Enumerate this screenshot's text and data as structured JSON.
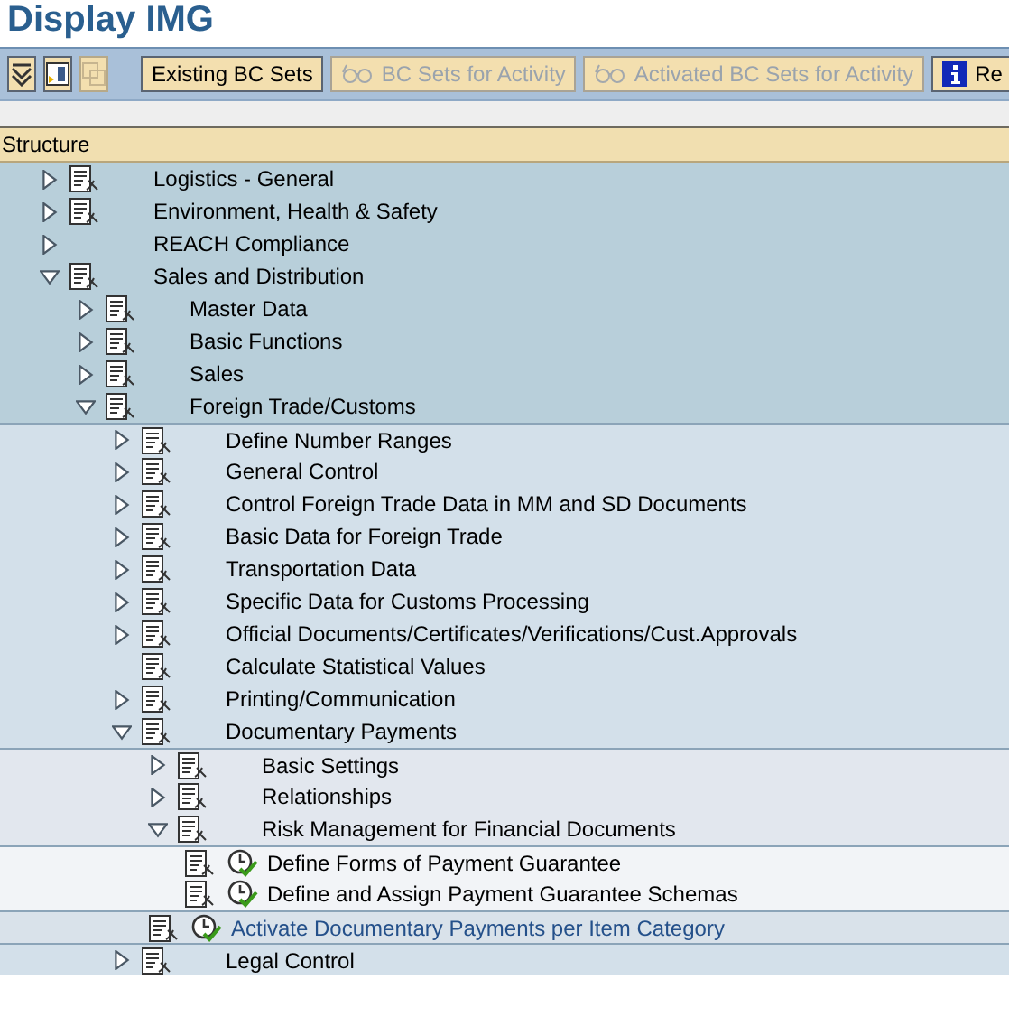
{
  "title": "Display IMG",
  "toolbar": [
    {
      "kind": "icon",
      "disabled": false
    },
    {
      "kind": "icon",
      "disabled": false
    },
    {
      "kind": "icon",
      "disabled": true
    },
    {
      "kind": "text",
      "label": "Existing BC Sets",
      "disabled": false
    },
    {
      "kind": "text",
      "label": "BC Sets for Activity",
      "disabled": true
    },
    {
      "kind": "text",
      "label": "Activated BC Sets for Activity",
      "disabled": true
    },
    {
      "kind": "text",
      "label": "Re",
      "disabled": false
    }
  ],
  "tree_header": "Structure",
  "tree": [
    {
      "label": "Logistics - General",
      "expandable": true,
      "expanded": false,
      "doc_icon": true,
      "activity_icon": false,
      "selected": false
    },
    {
      "label": "Environment, Health & Safety",
      "expandable": true,
      "expanded": false,
      "doc_icon": true,
      "activity_icon": false,
      "selected": false
    },
    {
      "label": "REACH Compliance",
      "expandable": true,
      "expanded": false,
      "doc_icon": false,
      "activity_icon": false,
      "selected": false
    },
    {
      "label": "Sales and Distribution",
      "expandable": true,
      "expanded": true,
      "doc_icon": true,
      "activity_icon": false,
      "selected": false,
      "children": [
        {
          "label": "Master Data",
          "expandable": true,
          "expanded": false,
          "doc_icon": true,
          "activity_icon": false,
          "selected": false
        },
        {
          "label": "Basic Functions",
          "expandable": true,
          "expanded": false,
          "doc_icon": true,
          "activity_icon": false,
          "selected": false
        },
        {
          "label": "Sales",
          "expandable": true,
          "expanded": false,
          "doc_icon": true,
          "activity_icon": false,
          "selected": false
        },
        {
          "label": "Foreign Trade/Customs",
          "expandable": true,
          "expanded": true,
          "doc_icon": true,
          "activity_icon": false,
          "selected": false,
          "children": [
            {
              "label": "Define Number Ranges",
              "expandable": true,
              "expanded": false,
              "doc_icon": true,
              "activity_icon": false,
              "selected": false
            },
            {
              "label": "General Control",
              "expandable": true,
              "expanded": false,
              "doc_icon": true,
              "activity_icon": false,
              "selected": false
            },
            {
              "label": "Control Foreign Trade Data in MM and SD Documents",
              "expandable": true,
              "expanded": false,
              "doc_icon": true,
              "activity_icon": false,
              "selected": false
            },
            {
              "label": "Basic Data for Foreign Trade",
              "expandable": true,
              "expanded": false,
              "doc_icon": true,
              "activity_icon": false,
              "selected": false
            },
            {
              "label": "Transportation Data",
              "expandable": true,
              "expanded": false,
              "doc_icon": true,
              "activity_icon": false,
              "selected": false
            },
            {
              "label": "Specific Data for Customs Processing",
              "expandable": true,
              "expanded": false,
              "doc_icon": true,
              "activity_icon": false,
              "selected": false
            },
            {
              "label": "Official Documents/Certificates/Verifications/Cust.Approvals",
              "expandable": true,
              "expanded": false,
              "doc_icon": true,
              "activity_icon": false,
              "selected": false
            },
            {
              "label": "Calculate Statistical Values",
              "expandable": false,
              "expanded": false,
              "doc_icon": true,
              "activity_icon": false,
              "selected": false
            },
            {
              "label": "Printing/Communication",
              "expandable": true,
              "expanded": false,
              "doc_icon": true,
              "activity_icon": false,
              "selected": false
            },
            {
              "label": "Documentary Payments",
              "expandable": true,
              "expanded": true,
              "doc_icon": true,
              "activity_icon": false,
              "selected": false,
              "children": [
                {
                  "label": "Basic Settings",
                  "expandable": true,
                  "expanded": false,
                  "doc_icon": true,
                  "activity_icon": false,
                  "selected": false
                },
                {
                  "label": "Relationships",
                  "expandable": true,
                  "expanded": false,
                  "doc_icon": true,
                  "activity_icon": false,
                  "selected": false
                },
                {
                  "label": "Risk Management for Financial Documents",
                  "expandable": true,
                  "expanded": true,
                  "doc_icon": true,
                  "activity_icon": false,
                  "selected": false,
                  "children": [
                    {
                      "label": "Define Forms of Payment Guarantee",
                      "expandable": false,
                      "expanded": false,
                      "doc_icon": true,
                      "activity_icon": true,
                      "selected": false
                    },
                    {
                      "label": "Define and Assign Payment Guarantee Schemas",
                      "expandable": false,
                      "expanded": false,
                      "doc_icon": true,
                      "activity_icon": true,
                      "selected": false
                    }
                  ]
                },
                {
                  "label": "Activate Documentary Payments per Item Category",
                  "expandable": false,
                  "expanded": false,
                  "doc_icon": true,
                  "activity_icon": true,
                  "selected": true
                }
              ]
            },
            {
              "label": "Legal Control",
              "expandable": true,
              "expanded": false,
              "doc_icon": true,
              "activity_icon": false,
              "selected": false
            }
          ]
        }
      ]
    }
  ]
}
